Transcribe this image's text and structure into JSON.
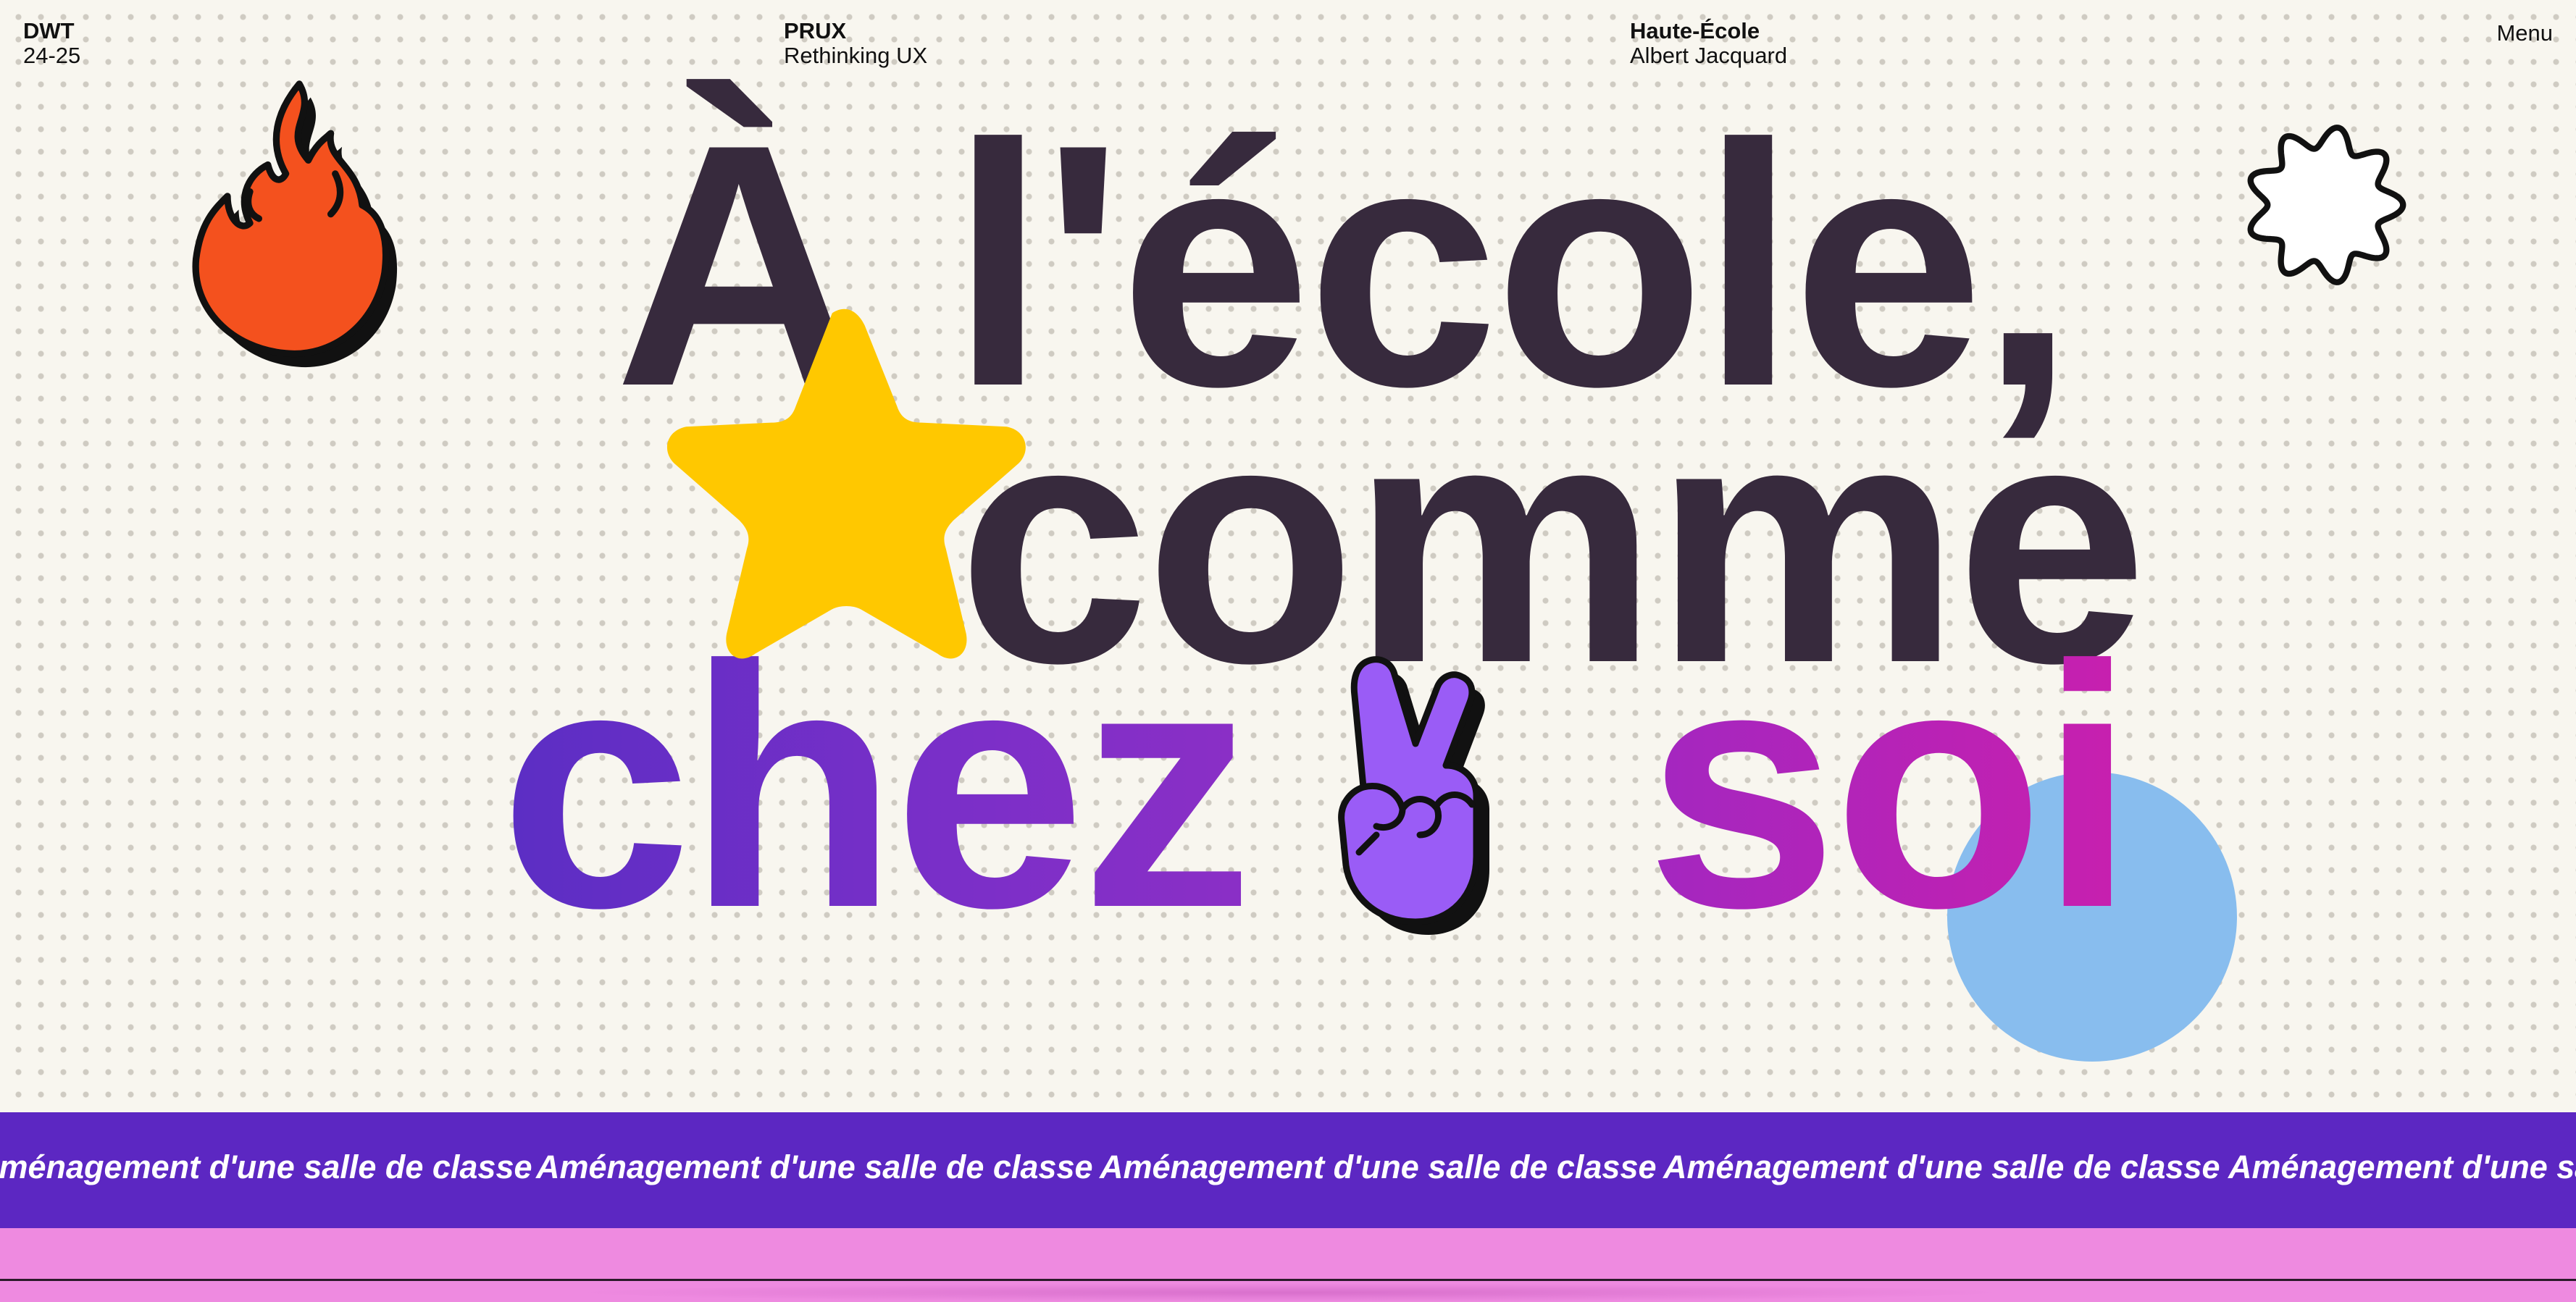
{
  "header": {
    "col1": {
      "title": "DWT",
      "subtitle": "24-25"
    },
    "col2": {
      "title": "PRUX",
      "subtitle": "Rethinking UX"
    },
    "col3": {
      "title": "Haute-École",
      "subtitle": "Albert Jacquard"
    },
    "menu_label": "Menu"
  },
  "hero": {
    "line1": "À l'école,",
    "line2": "comme",
    "line3_part1": "chez",
    "line3_part2": "soi"
  },
  "decorations": {
    "icons": [
      "flame-icon",
      "star-icon",
      "peace-hand-icon",
      "flower-outline-icon",
      "blue-circle-shape"
    ]
  },
  "banner": {
    "text": "Aménagement d'une salle de classe"
  },
  "colors": {
    "background": "#f8f6ef",
    "title_dark": "#372a3d",
    "purple": "#5c27c2",
    "magenta": "#c81fae",
    "star_yellow": "#ffc800",
    "flame_orange": "#f4511e",
    "circle_blue": "#88bdee",
    "pink_band": "#ee8ae0"
  }
}
